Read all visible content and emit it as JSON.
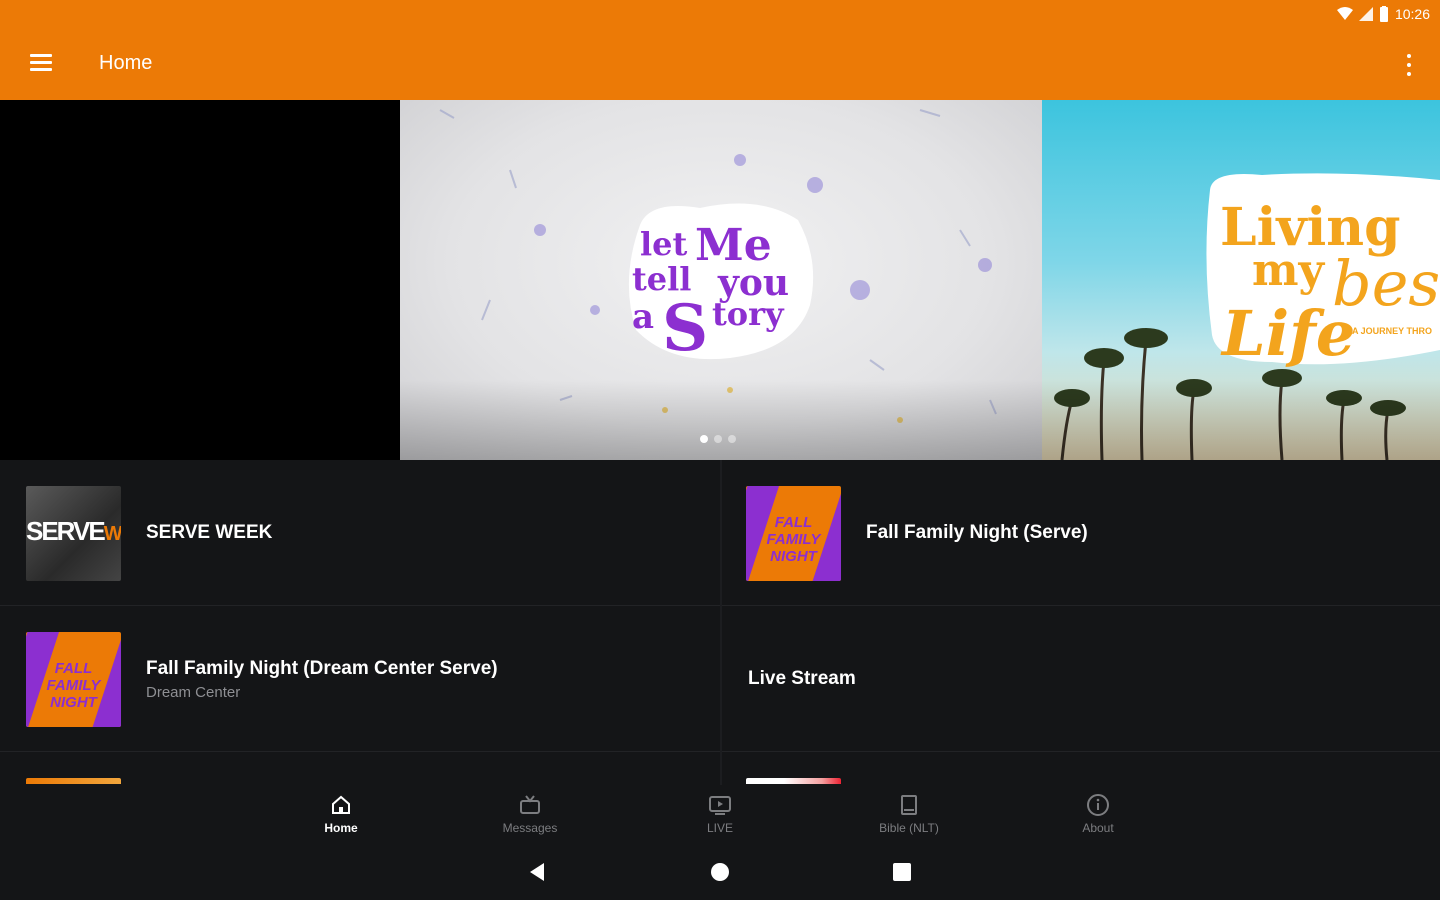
{
  "status": {
    "time": "10:26"
  },
  "appbar": {
    "title": "Home"
  },
  "carousel": {
    "center_title_lines": [
      "let",
      "Me",
      "tell",
      "you",
      "a",
      "S",
      "tory"
    ],
    "right_title_lines": [
      "Living",
      "my",
      "bes",
      "Life"
    ],
    "right_subtitle": "A JOURNEY THRO",
    "page_count": 3,
    "active_index": 0
  },
  "items": [
    {
      "title": "SERVE WEEK",
      "subtitle": "",
      "thumb_text_a": "SERVE",
      "thumb_text_b": "WEEK"
    },
    {
      "title": "Fall Family Night (Serve)",
      "subtitle": "",
      "thumb_text": "FALL FAMILY NIGHT"
    },
    {
      "title": "Fall Family Night (Dream Center Serve)",
      "subtitle": "Dream Center",
      "thumb_text": "FALL FAMILY NIGHT"
    },
    {
      "title": "Live Stream",
      "subtitle": ""
    }
  ],
  "bottom_nav": [
    {
      "label": "Home",
      "icon": "home-icon",
      "active": true
    },
    {
      "label": "Messages",
      "icon": "tv-messages-icon",
      "active": false
    },
    {
      "label": "LIVE",
      "icon": "live-tv-icon",
      "active": false
    },
    {
      "label": "Bible (NLT)",
      "icon": "book-icon",
      "active": false
    },
    {
      "label": "About",
      "icon": "info-icon",
      "active": false
    }
  ],
  "colors": {
    "brand": "#ec7a06",
    "accent_purple": "#8c2fd0",
    "background": "#141517"
  }
}
